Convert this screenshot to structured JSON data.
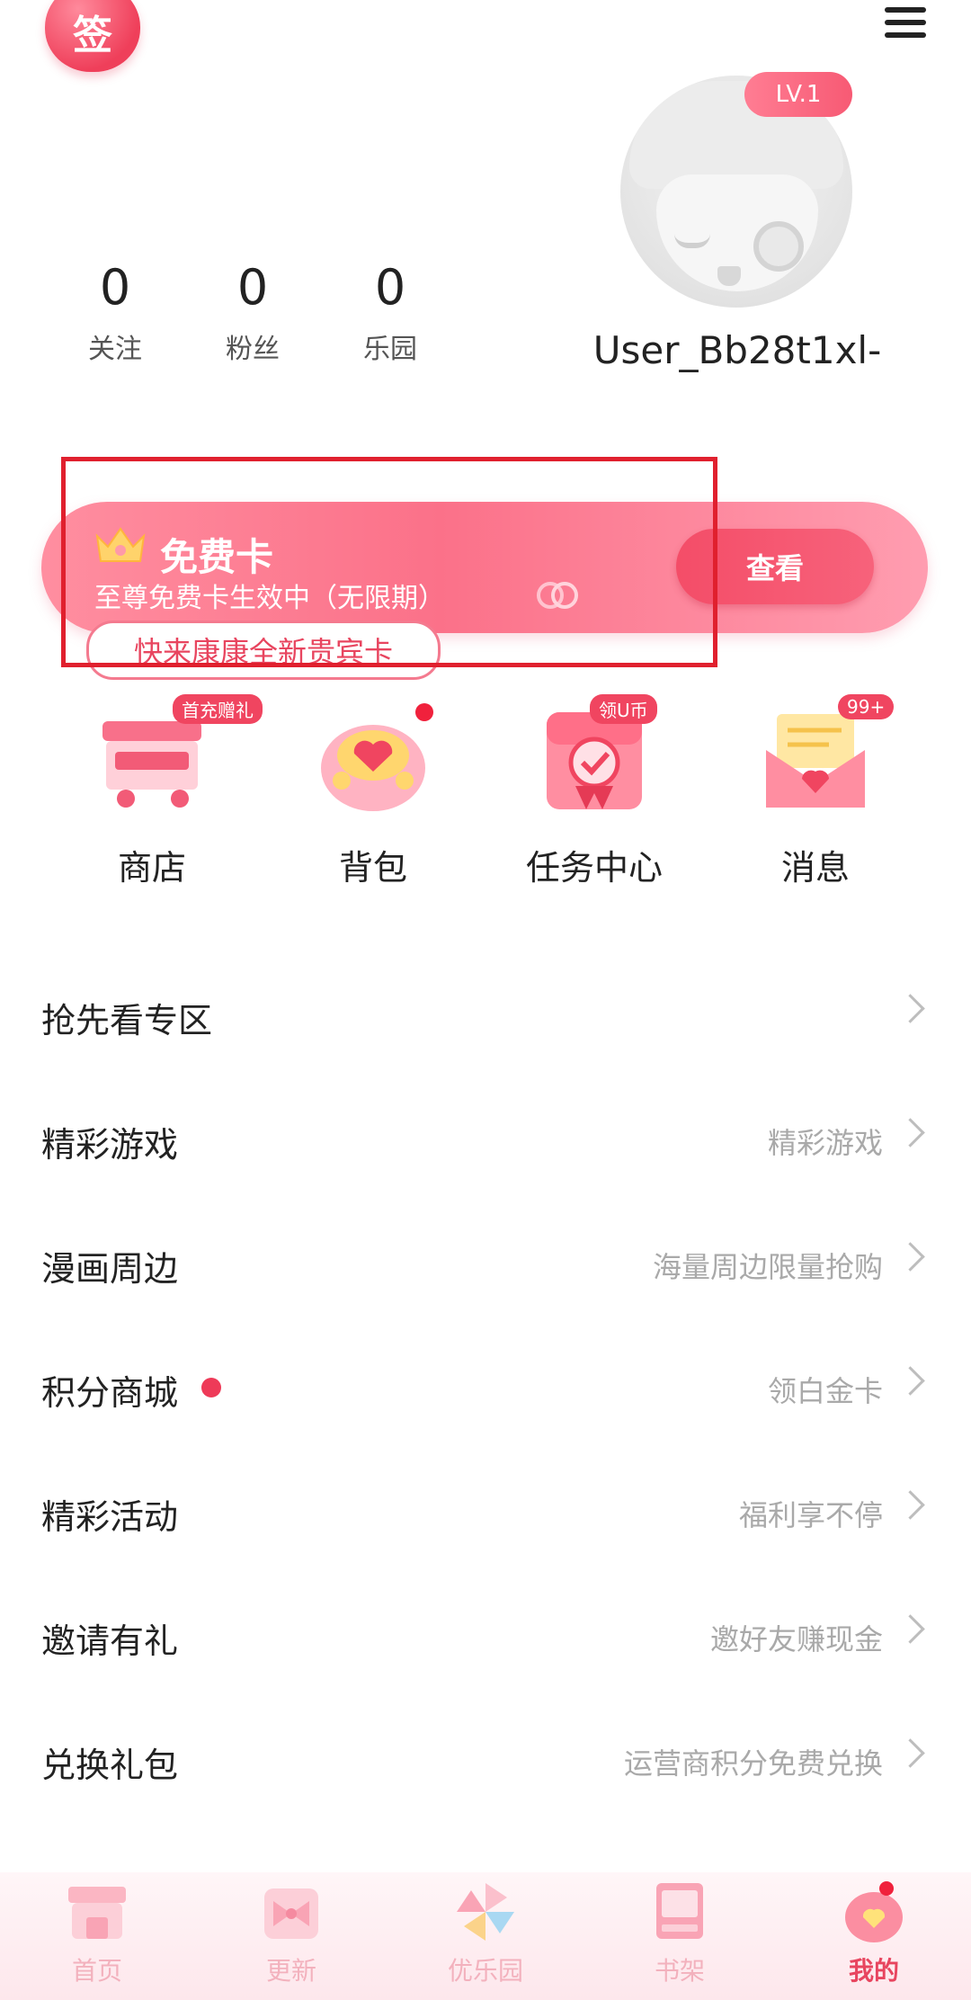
{
  "header": {
    "sign_label": "签"
  },
  "profile": {
    "level": "LV.1",
    "username": "User_Bb28t1xl-",
    "stats": [
      {
        "value": "0",
        "label": "关注"
      },
      {
        "value": "0",
        "label": "粉丝"
      },
      {
        "value": "0",
        "label": "乐园"
      }
    ]
  },
  "free_card": {
    "title": "免费卡",
    "subtitle": "至尊免费卡生效中（无限期）",
    "button": "查看",
    "bubble": "快来康康全新贵宾卡"
  },
  "grid": [
    {
      "label": "商店",
      "tag": "首充赠礼",
      "icon": "shop-cart-icon"
    },
    {
      "label": "背包",
      "tag": "",
      "icon": "backpack-icon"
    },
    {
      "label": "任务中心",
      "tag": "领U币",
      "icon": "task-gift-icon"
    },
    {
      "label": "消息",
      "tag": "99+",
      "icon": "message-envelope-icon"
    }
  ],
  "menu": [
    {
      "title": "抢先看专区",
      "sub": ""
    },
    {
      "title": "精彩游戏",
      "sub": "精彩游戏"
    },
    {
      "title": "漫画周边",
      "sub": "海量周边限量抢购"
    },
    {
      "title": "积分商城",
      "sub": "领白金卡"
    },
    {
      "title": "精彩活动",
      "sub": "福利享不停"
    },
    {
      "title": "邀请有礼",
      "sub": "邀好友赚现金"
    },
    {
      "title": "兑换礼包",
      "sub": "运营商积分免费兑换"
    }
  ],
  "tabs": [
    {
      "label": "首页",
      "icon": "home-store-icon"
    },
    {
      "label": "更新",
      "icon": "update-bow-icon"
    },
    {
      "label": "优乐园",
      "icon": "pinwheel-icon"
    },
    {
      "label": "书架",
      "icon": "bookshelf-icon"
    },
    {
      "label": "我的",
      "icon": "heart-bag-icon"
    }
  ],
  "colors": {
    "accent": "#f04560",
    "banner": "#fb7189",
    "highlight_box": "#e0202e"
  }
}
